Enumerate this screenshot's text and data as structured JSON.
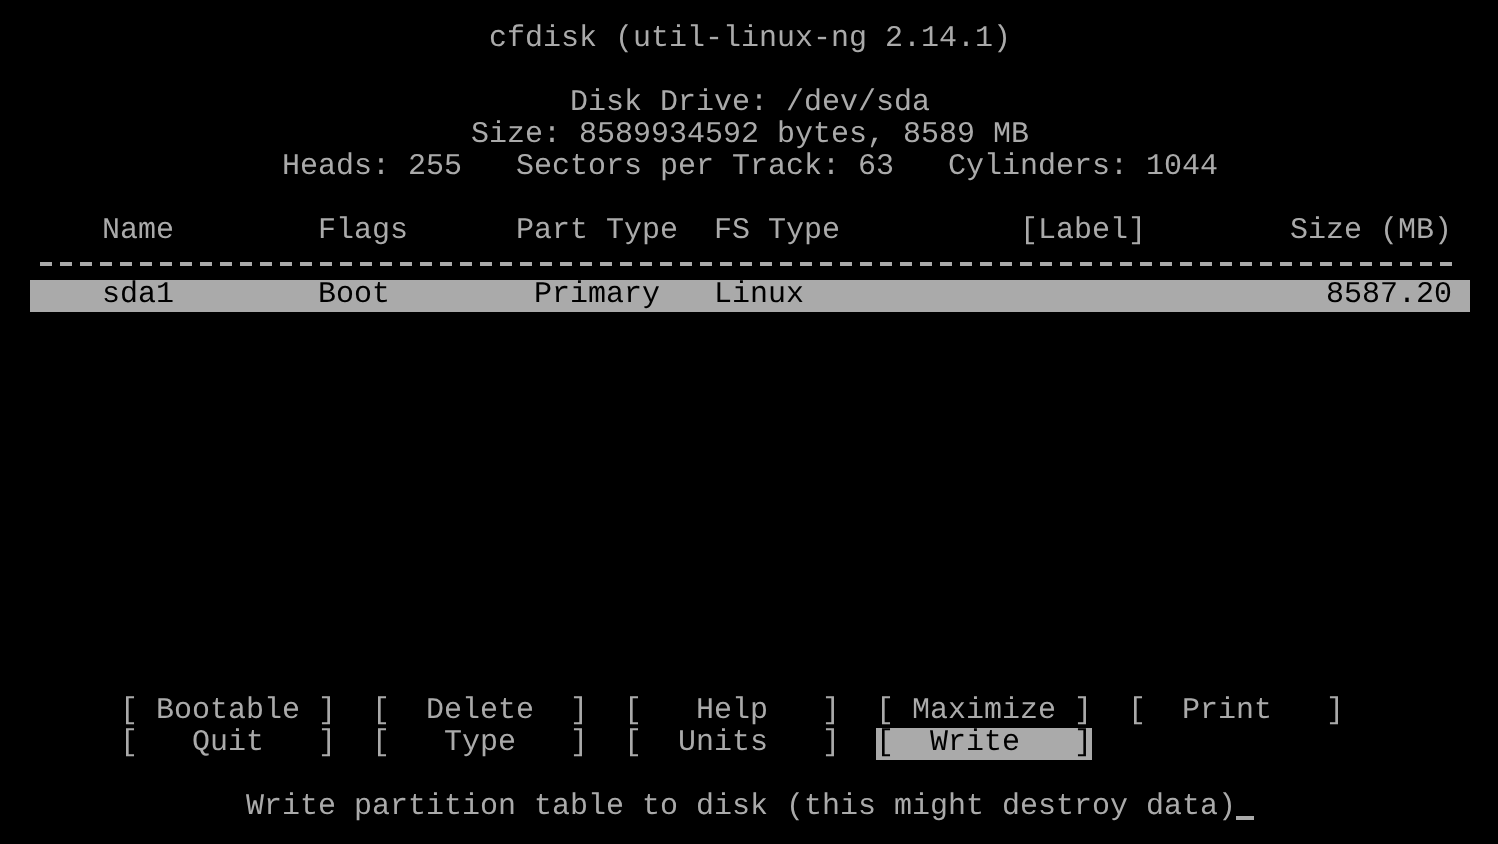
{
  "title": "cfdisk (util-linux-ng 2.14.1)",
  "disk": {
    "drive": "Disk Drive: /dev/sda",
    "size": "Size: 8589934592 bytes, 8589 MB",
    "heads": "Heads: 255",
    "sectors": "Sectors per Track: 63",
    "cylinders": "Cylinders: 1044"
  },
  "table": {
    "columns": [
      "Name",
      "Flags",
      "Part Type",
      "FS Type",
      "[Label]",
      "Size (MB)"
    ],
    "rows": [
      {
        "name": "sda1",
        "flags": "Boot",
        "part_type": "Primary",
        "fs_type": "Linux",
        "size": "8587.20",
        "selected": true
      }
    ]
  },
  "menu": [
    [
      {
        "label": "[ Bootable ]",
        "selected": false
      },
      {
        "label": "[  Delete  ]",
        "selected": false
      },
      {
        "label": "[   Help   ]",
        "selected": false
      },
      {
        "label": "[ Maximize ]",
        "selected": false
      },
      {
        "label": "[  Print   ]",
        "selected": false
      }
    ],
    [
      {
        "label": "[   Quit   ]",
        "selected": false
      },
      {
        "label": "[   Type   ]",
        "selected": false
      },
      {
        "label": "[  Units   ]",
        "selected": false
      },
      {
        "label": "[  Write   ]",
        "selected": true
      }
    ]
  ],
  "status": "Write partition table to disk (this might destroy data)"
}
